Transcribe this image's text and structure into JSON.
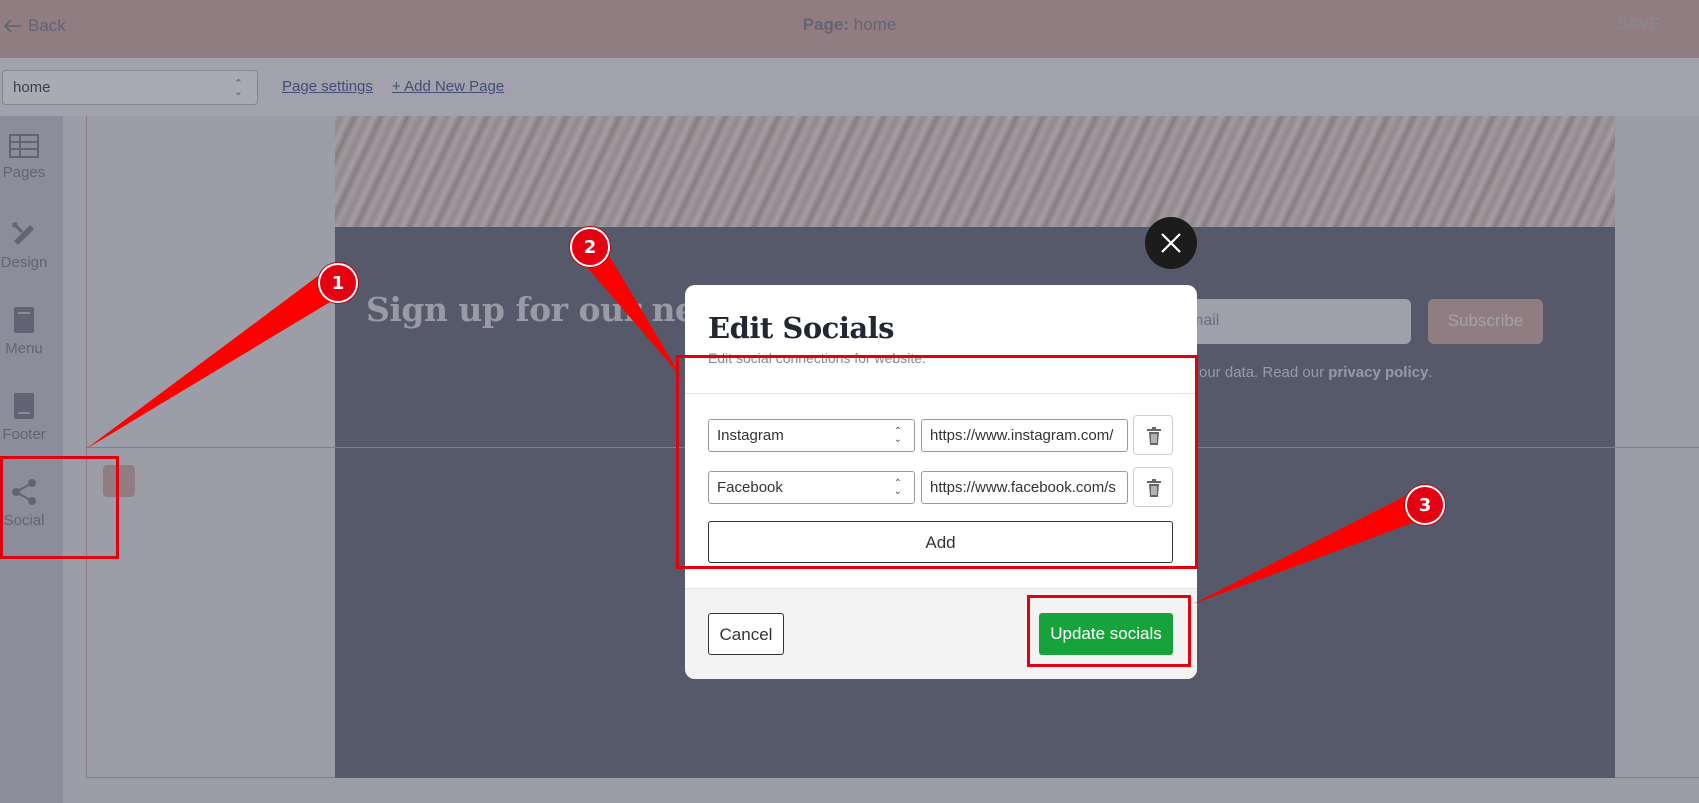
{
  "topbar": {
    "back_label": "Back",
    "page_title_prefix": "Page:",
    "page_title_value": "home",
    "save_label": "SAVE"
  },
  "toolbar": {
    "page_select_value": "home",
    "page_settings_label": "Page settings",
    "add_page_label": "+ Add New Page"
  },
  "sidenav": {
    "items": [
      {
        "label": "Pages",
        "icon": "table-icon"
      },
      {
        "label": "Design",
        "icon": "pencil-ruler-icon"
      },
      {
        "label": "Menu",
        "icon": "menu-book-icon"
      },
      {
        "label": "Footer",
        "icon": "footer-icon"
      },
      {
        "label": "Social",
        "icon": "share-icon"
      }
    ]
  },
  "newsletter": {
    "heading": "Sign up for our newsl",
    "email_placeholder": "mail",
    "subscribe_label": "Subscribe",
    "privacy_text": "our data. Read our",
    "privacy_link": "privacy policy",
    "privacy_end": "."
  },
  "modal": {
    "title": "Edit Socials",
    "subtitle": "Edit social connections for website.",
    "rows": [
      {
        "network": "Instagram",
        "url": "https://www.instagram.com/"
      },
      {
        "network": "Facebook",
        "url": "https://www.facebook.com/s"
      }
    ],
    "add_label": "Add",
    "cancel_label": "Cancel",
    "update_label": "Update socials"
  },
  "annotations": {
    "markers": [
      "1",
      "2",
      "3"
    ],
    "color": "#e50012"
  }
}
